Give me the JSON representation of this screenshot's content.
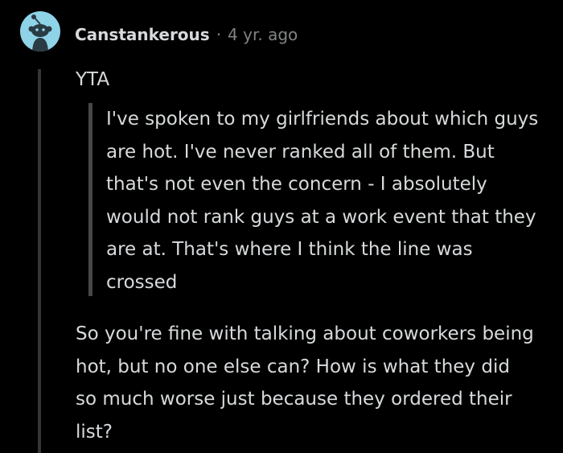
{
  "comment": {
    "avatar": {
      "icon": "reddit-snoo-avatar-icon",
      "background_color": "#8ed3e8"
    },
    "username": "Canstankerous",
    "separator": "·",
    "timestamp": "4 yr. ago",
    "paragraph_1": "YTA",
    "quote": "I've spoken to my girlfriends about which guys are hot. I've never ranked all of them. But that's not even the concern - I absolutely would not rank guys at a work event that they are at. That's where I think the line was crossed",
    "paragraph_2": "So you're fine with talking about coworkers being hot, but no one else can? How is what they did so much worse just because they ordered their list?"
  },
  "colors": {
    "background": "#000000",
    "text": "#d7dadc",
    "muted_text": "#818384",
    "thread_line": "#343536",
    "quote_bar": "#474748"
  }
}
